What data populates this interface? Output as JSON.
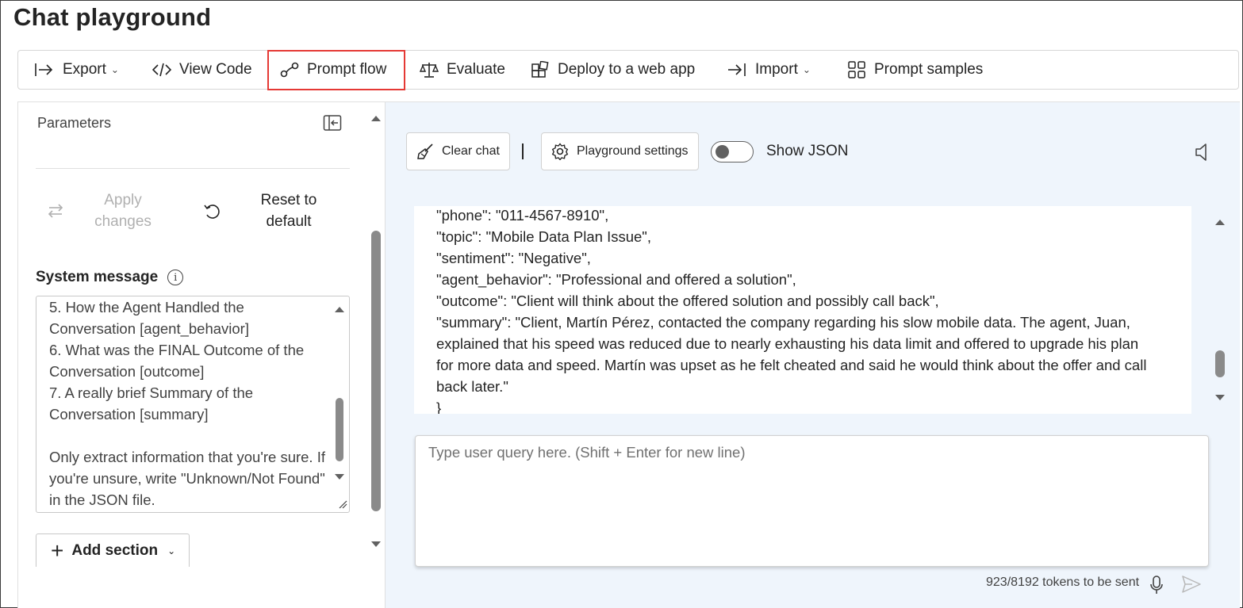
{
  "page": {
    "title": "Chat playground"
  },
  "toolbar": {
    "export_label": "Export",
    "view_code_label": "View Code",
    "prompt_flow_label": "Prompt flow",
    "evaluate_label": "Evaluate",
    "deploy_label": "Deploy to a web app",
    "import_label": "Import",
    "prompt_samples_label": "Prompt samples",
    "highlight_color": "#e53935"
  },
  "parameters": {
    "title": "Parameters",
    "apply_label_line1": "Apply",
    "apply_label_line2": "changes",
    "reset_label_line1": "Reset to",
    "reset_label_line2": "default",
    "system_message_label": "System message",
    "info_glyph": "i",
    "system_message_text": "5. How the Agent Handled the Conversation [agent_behavior]\n6. What was the FINAL Outcome of the Conversation [outcome]\n7. A really brief Summary of the Conversation [summary]\n\nOnly extract information that you're sure. If you're unsure, write \"Unknown/Not Found\" in the JSON file.",
    "add_section_label": "Add section"
  },
  "chat": {
    "clear_chat_label": "Clear chat",
    "playground_settings_label": "Playground settings",
    "show_json_label": "Show JSON",
    "show_json_on": false,
    "lines": [
      "\"phone\": \"011-4567-8910\",",
      "\"topic\": \"Mobile Data Plan Issue\",",
      "\"sentiment\": \"Negative\",",
      "\"agent_behavior\": \"Professional and offered a solution\",",
      "\"outcome\": \"Client will think about the offered solution and possibly call back\",",
      "\"summary\": \"Client, Martín Pérez, contacted the company regarding his slow mobile data. The agent, Juan,",
      "explained that his speed was reduced due to nearly exhausting his data limit and offered to upgrade his plan",
      "for more data and speed. Martín was upset as he felt cheated and said he would think about the offer and call",
      "back later.\"",
      "}"
    ],
    "input_placeholder": "Type user query here. (Shift + Enter for new line)",
    "tokens_text": "923/8192 tokens to be sent"
  },
  "colors": {
    "right_panel_bg": "#eff5fc",
    "scroll_thumb": "#8a8a8a"
  }
}
